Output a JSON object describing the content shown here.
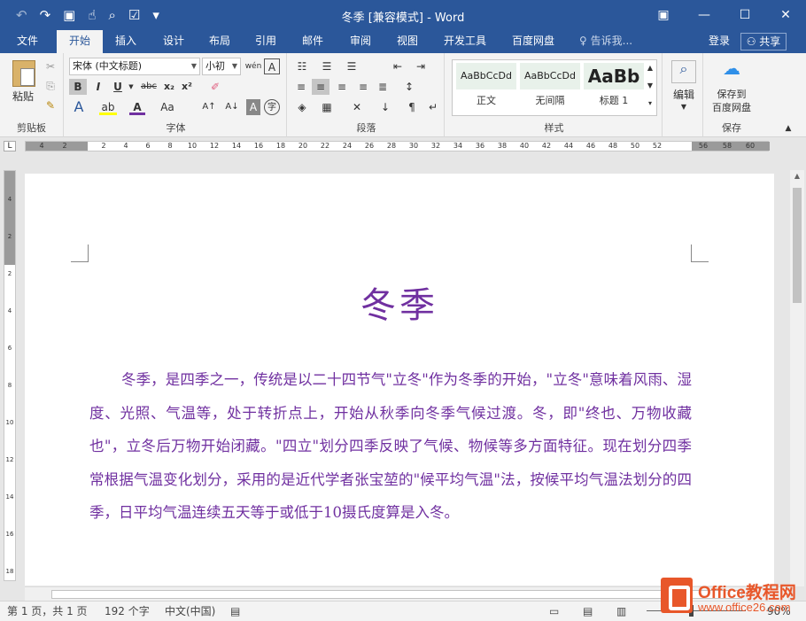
{
  "window": {
    "title": "冬季 [兼容模式] - Word",
    "controls": {
      "ribbon_display": "▣",
      "minimize": "—",
      "maximize": "☐",
      "close": "✕"
    }
  },
  "quick_access": {
    "undo": "↶",
    "redo": "↷",
    "save": "▣",
    "touch_mode": "☝",
    "print_preview": "⌕",
    "accessibility": "☑",
    "customize": "▾"
  },
  "ribbon_tabs": [
    "文件",
    "开始",
    "插入",
    "设计",
    "布局",
    "引用",
    "邮件",
    "审阅",
    "视图",
    "开发工具",
    "百度网盘"
  ],
  "active_tab": "开始",
  "tell_me": "告诉我...",
  "account": {
    "login": "登录",
    "share": "共享"
  },
  "ribbon": {
    "clipboard": {
      "label": "剪贴板",
      "paste": "粘贴"
    },
    "font": {
      "label": "字体",
      "font_name": "宋体 (中文标题)",
      "font_size": "小初",
      "bold": "B",
      "italic": "I",
      "underline": "U",
      "strikethrough": "abc",
      "subscript": "x₂",
      "superscript": "x²",
      "text_effects": "A",
      "highlight": "ab",
      "font_color": "A",
      "change_case": "Aa",
      "grow": "A↑",
      "shrink": "A↓",
      "char_shading": "A",
      "enclose": "字",
      "pinyin": "wén",
      "char_border": "A"
    },
    "paragraph": {
      "label": "段落"
    },
    "styles": {
      "label": "样式",
      "items": [
        {
          "sample": "AaBbCcDd",
          "name": "正文"
        },
        {
          "sample": "AaBbCcDd",
          "name": "无间隔"
        },
        {
          "sample": "AaBb",
          "name": "标题 1"
        }
      ]
    },
    "editing": {
      "label": "编辑"
    },
    "save": {
      "label": "保存",
      "button_line1": "保存到",
      "button_line2": "百度网盘"
    }
  },
  "ruler": {
    "corner": "L",
    "numbers": [
      "4",
      "2",
      "2",
      "4",
      "6",
      "8",
      "10",
      "12",
      "14",
      "16",
      "18",
      "20",
      "22",
      "24",
      "26",
      "28",
      "30",
      "32",
      "34",
      "36",
      "38",
      "40",
      "42",
      "44",
      "46",
      "48",
      "50",
      "52",
      "56",
      "58",
      "60"
    ],
    "vertical_numbers": [
      "4",
      "2",
      "2",
      "4",
      "6",
      "8",
      "10",
      "12",
      "14",
      "16",
      "18"
    ]
  },
  "document": {
    "heading": "冬季",
    "paragraph": "冬季，是四季之一，传统是以二十四节气\"立冬\"作为冬季的开始，\"立冬\"意味着风雨、湿度、光照、气温等，处于转折点上，开始从秋季向冬季气候过渡。冬，即\"终也、万物收藏也\"，立冬后万物开始闭藏。\"四立\"划分四季反映了气候、物候等多方面特征。现在划分四季常根据气温变化划分，采用的是近代学者张宝堃的\"候平均气温\"法，按候平均气温法划分的四季，日平均气温连续五天等于或低于10摄氏度算是入冬。"
  },
  "status_bar": {
    "page": "第 1 页，共 1 页",
    "words": "192 个字",
    "language": "中文(中国)",
    "zoom": "90%"
  },
  "watermark": {
    "brand": "Office教程网",
    "url": "www.office26.com"
  },
  "colors": {
    "title_bar": "#2b579a",
    "text": "#7030a0",
    "watermark": "#e8572a"
  }
}
